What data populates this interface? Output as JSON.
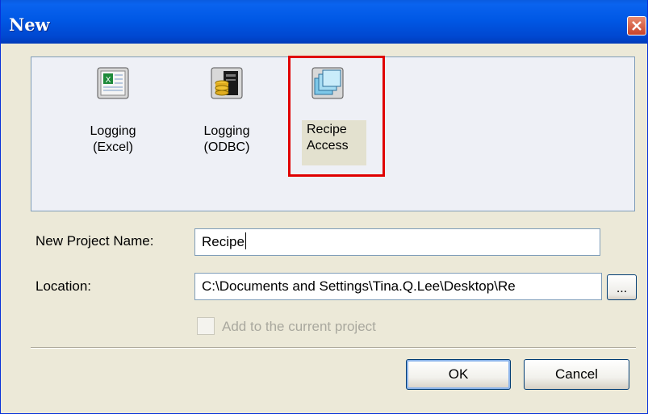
{
  "window": {
    "title": "New"
  },
  "templates": [
    {
      "line1": "Logging",
      "line2": "(Excel)",
      "icon": "excel-sheet-icon"
    },
    {
      "line1": "Logging",
      "line2": "(ODBC)",
      "icon": "database-icon"
    },
    {
      "line1": "Recipe",
      "line2": "Access",
      "icon": "recipe-windows-icon",
      "selected": true
    }
  ],
  "form": {
    "project_name_label": "New Project Name:",
    "project_name_value": "Recipe",
    "location_label": "Location:",
    "location_value": "C:\\Documents and Settings\\Tina.Q.Lee\\Desktop\\Re",
    "browse_label": "...",
    "add_to_project_label": "Add to the current project",
    "add_to_project_checked": false
  },
  "buttons": {
    "ok": "OK",
    "cancel": "Cancel"
  },
  "colors": {
    "titlebar": "#0054e3",
    "highlight_border": "#e00000",
    "dialog_bg": "#ece9d8"
  }
}
